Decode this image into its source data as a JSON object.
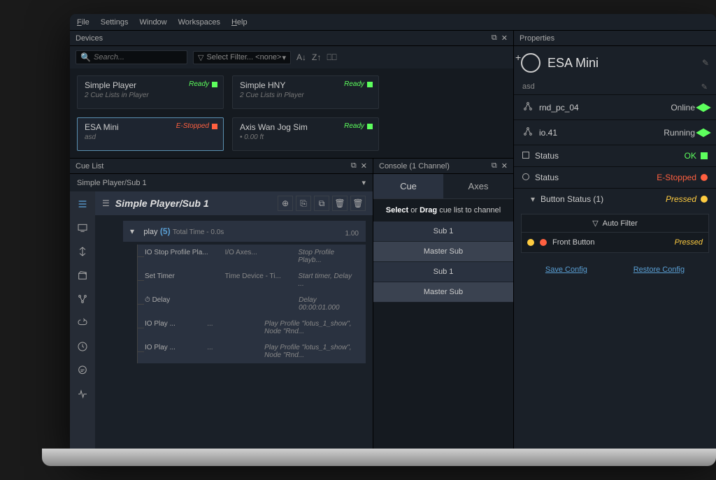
{
  "menubar": {
    "file": "File",
    "settings": "Settings",
    "window": "Window",
    "workspaces": "Workspaces",
    "help": "Help"
  },
  "devices": {
    "title": "Devices",
    "search_placeholder": "Search...",
    "filter_label": "Select Filter... <none>",
    "cards": [
      {
        "title": "Simple Player",
        "subtitle": "2 Cue Lists in Player",
        "status": "Ready",
        "status_class": "green"
      },
      {
        "title": "Simple HNY",
        "subtitle": "2 Cue Lists in Player",
        "status": "Ready",
        "status_class": "green"
      },
      {
        "title": "ESA Mini",
        "subtitle": "asd",
        "status": "E-Stopped",
        "status_class": "red"
      },
      {
        "title": "Axis Wan Jog Sim",
        "subtitle": "• 0.00 ft",
        "status": "Ready",
        "status_class": "green"
      }
    ]
  },
  "cuelist": {
    "title": "Cue List",
    "dropdown": "Simple Player/Sub 1",
    "main_title": "Simple Player/Sub 1",
    "play_label": "play",
    "play_num": "(5)",
    "total_label": "Total Time -  0.0s",
    "right_val": "1.00",
    "rows": [
      {
        "col1": "IO Stop Profile Pla...",
        "col2": "I/O Axes...",
        "col3": "Stop Profile Playb..."
      },
      {
        "col1": "Set Timer",
        "col2": "Time Device - Ti...",
        "col3": "Start timer, Delay ..."
      },
      {
        "col1": "⏱  Delay",
        "col2": "",
        "col3": "Delay 00:00:01.000"
      },
      {
        "col1": "IO Play ...",
        "col2": "...",
        "col3": "Play Profile \"lotus_1_show\", Node \"Rnd..."
      },
      {
        "col1": "IO Play ...",
        "col2": "...",
        "col3": "Play Profile \"lotus_1_show\", Node \"Rnd..."
      }
    ]
  },
  "console": {
    "title": "Console (1 Channel)",
    "tab_cue": "Cue",
    "tab_axes": "Axes",
    "instruction_select": "Select",
    "instruction_or": "or",
    "instruction_drag": "Drag",
    "instruction_rest": "cue list to channel",
    "items": [
      "Sub 1",
      "Master Sub",
      "Sub 1",
      "Master Sub"
    ]
  },
  "properties": {
    "title": "Properties",
    "main_title": "ESA Mini",
    "subtitle": "asd",
    "rows": [
      {
        "icon": "network",
        "label": "rnd_pc_04",
        "value": "Online",
        "badge": "cube"
      },
      {
        "icon": "network",
        "label": "io.41",
        "value": "Running",
        "badge": "cube"
      },
      {
        "icon": "square",
        "label": "Status",
        "value": "OK",
        "badge": "sq-green",
        "value_color": "#5dff5d"
      },
      {
        "icon": "circle",
        "label": "Status",
        "value": "E-Stopped",
        "badge": "circ-red",
        "value_color": "#ff6040"
      },
      {
        "icon": "chevron",
        "label": "Button Status (1)",
        "value": "Pressed",
        "badge": "circ-yellow",
        "value_color": "#ffcc40",
        "indent": true,
        "italic": true
      }
    ],
    "auto_filter": "Auto Filter",
    "filter_item": {
      "name": "Front Button",
      "value": "Pressed"
    },
    "save_config": "Save Config",
    "restore_config": "Restore Config"
  }
}
